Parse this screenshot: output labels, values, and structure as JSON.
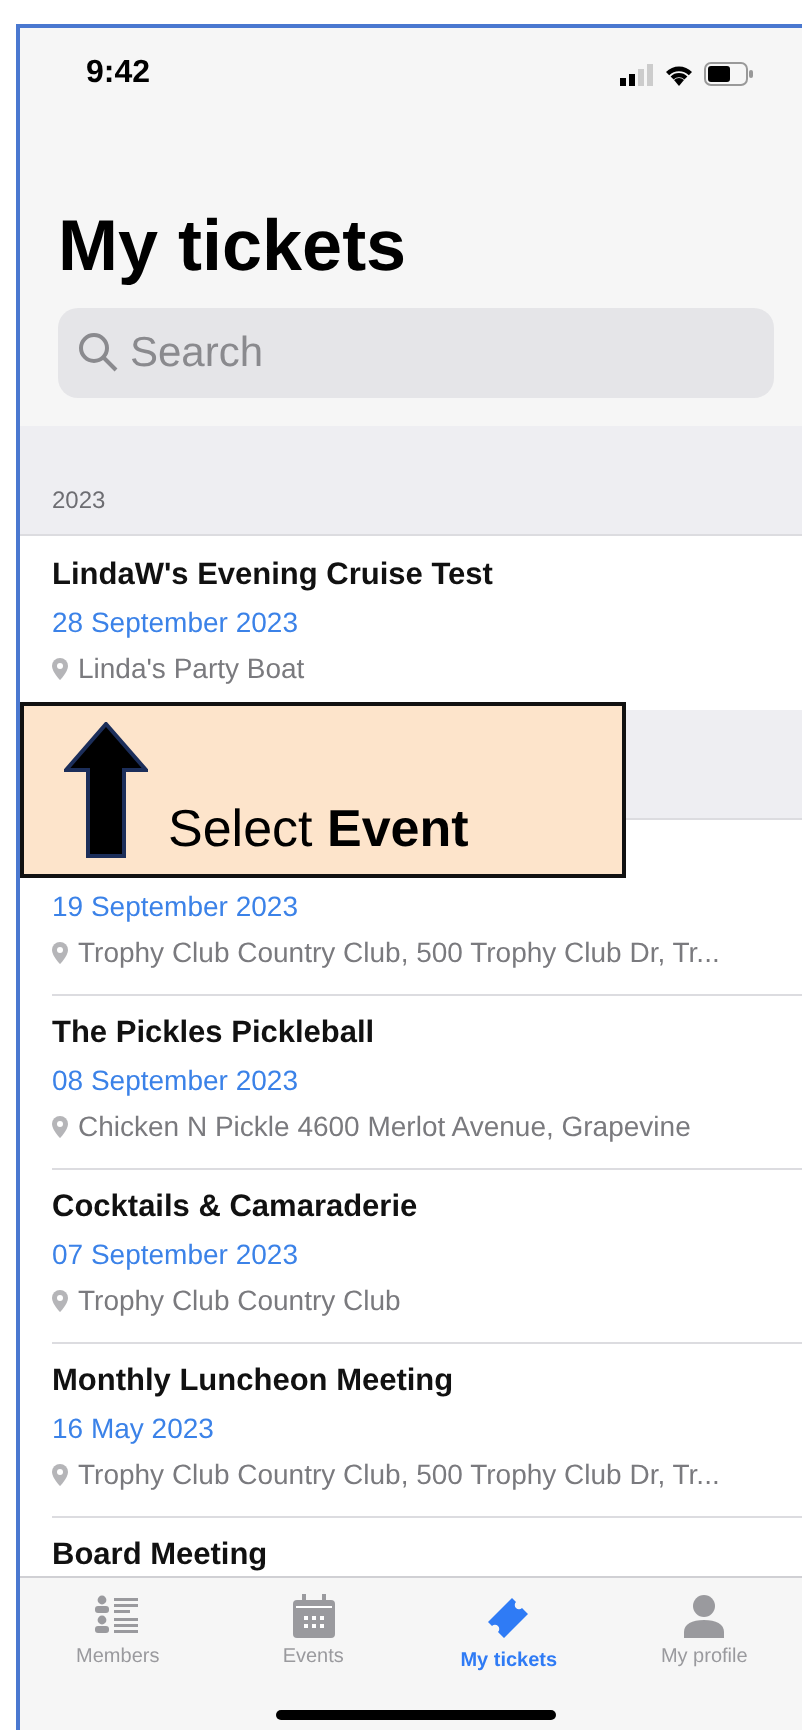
{
  "status_bar": {
    "time": "9:42"
  },
  "title": "My tickets",
  "search": {
    "placeholder": "Search"
  },
  "sections": [
    {
      "header": "2023",
      "items": [
        {
          "title": "LindaW's Evening Cruise Test",
          "date": "28 September 2023",
          "location": "Linda's Party Boat"
        }
      ]
    },
    {
      "items": [
        {
          "date": "19 September 2023",
          "location": "Trophy Club Country Club, 500 Trophy Club Dr, Tr..."
        },
        {
          "title": "The Pickles Pickleball",
          "date": "08 September 2023",
          "location": "Chicken N Pickle 4600 Merlot Avenue, Grapevine"
        },
        {
          "title": "Cocktails & Camaraderie",
          "date": "07 September 2023",
          "location": "Trophy Club Country Club"
        },
        {
          "title": "Monthly Luncheon Meeting",
          "date": "16 May 2023",
          "location": "Trophy Club Country Club, 500 Trophy Club Dr, Tr..."
        },
        {
          "title": "Board Meeting"
        }
      ]
    }
  ],
  "callout": {
    "text": "Select **Event**"
  },
  "tabs": [
    {
      "kind": "members",
      "label": "Members",
      "selected": false
    },
    {
      "kind": "events",
      "label": "Events",
      "selected": false
    },
    {
      "kind": "tickets",
      "label": "My tickets",
      "selected": true
    },
    {
      "kind": "profile",
      "label": "My profile",
      "selected": false
    }
  ]
}
